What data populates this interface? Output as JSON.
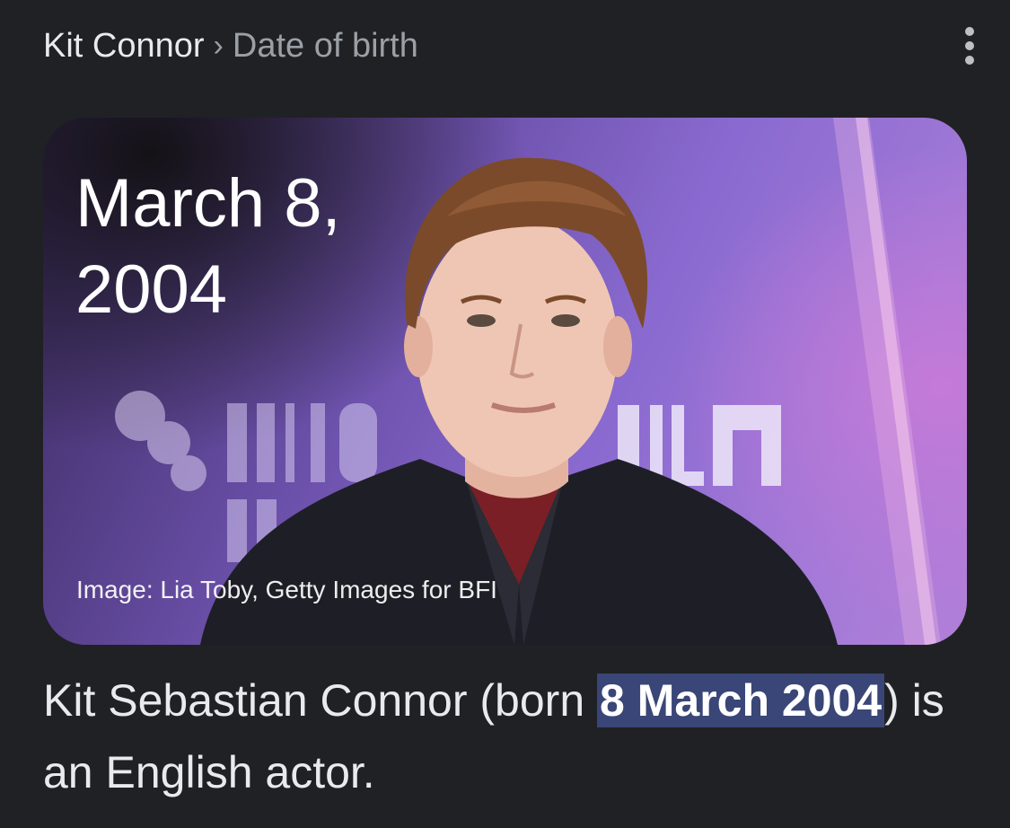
{
  "breadcrumb": {
    "root": "Kit Connor",
    "separator": "›",
    "current": "Date of birth"
  },
  "menu": {
    "icon": "more-vert-icon"
  },
  "card": {
    "date_line1": "March 8,",
    "date_line2": "2004",
    "credit": "Image: Lia Toby, Getty Images for BFI",
    "backdrop_text": "BFI LONDON FILM FESTIVAL",
    "colors": {
      "backdrop": "#8a6ad0",
      "text": "#ffffff"
    }
  },
  "description": {
    "before": "Kit Sebastian Connor (born ",
    "highlight": "8 March 2004",
    "after": ") is an English actor."
  },
  "theme": {
    "background": "#202124",
    "text": "#e8eaed",
    "muted": "#9aa0a6",
    "highlight_bg": "#394677"
  }
}
